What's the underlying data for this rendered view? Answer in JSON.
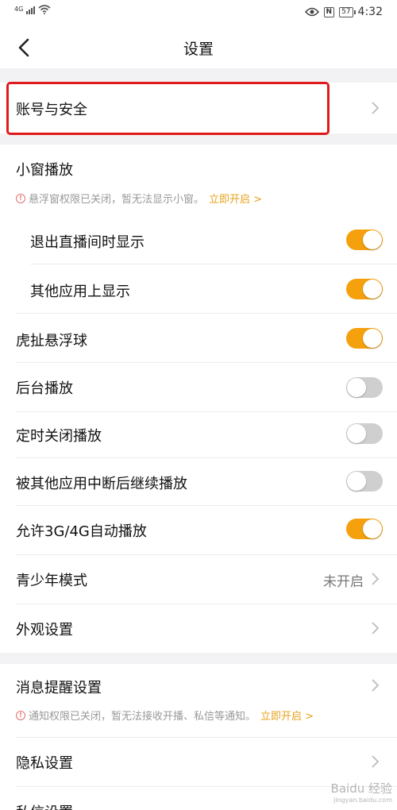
{
  "status_bar": {
    "network": "4G",
    "time": "4:32",
    "battery": "57",
    "nfc": "N"
  },
  "nav": {
    "title": "设置"
  },
  "section1": {
    "account_security": "账号与安全"
  },
  "section2": {
    "mini_window": {
      "label": "小窗播放",
      "warning_text": "悬浮窗权限已关闭，暂无法显示小窗。",
      "warning_link": "立即开启 >"
    },
    "items": [
      {
        "label": "退出直播间时显示",
        "state": "on"
      },
      {
        "label": "其他应用上显示",
        "state": "on"
      },
      {
        "label": "虎扯悬浮球",
        "state": "on"
      },
      {
        "label": "后台播放",
        "state": "off"
      },
      {
        "label": "定时关闭播放",
        "state": "off"
      },
      {
        "label": "被其他应用中断后继续播放",
        "state": "off"
      },
      {
        "label": "允许3G/4G自动播放",
        "state": "on"
      }
    ],
    "teen_mode": {
      "label": "青少年模式",
      "value": "未开启"
    },
    "appearance": {
      "label": "外观设置"
    }
  },
  "section3": {
    "notifications": {
      "label": "消息提醒设置",
      "warning_text": "通知权限已关闭，暂无法接收开播、私信等通知。",
      "warning_link": "立即开启 >"
    },
    "privacy": {
      "label": "隐私设置"
    },
    "messages": {
      "label": "私信设置"
    }
  },
  "watermark": {
    "text": "Baidu 经验",
    "sub": "jingyan.baidu.com"
  },
  "colors": {
    "accent": "#f5a00d",
    "toggle_off": "#cfcfcf",
    "highlight": "#e01a1a",
    "link": "#e8a21a"
  }
}
